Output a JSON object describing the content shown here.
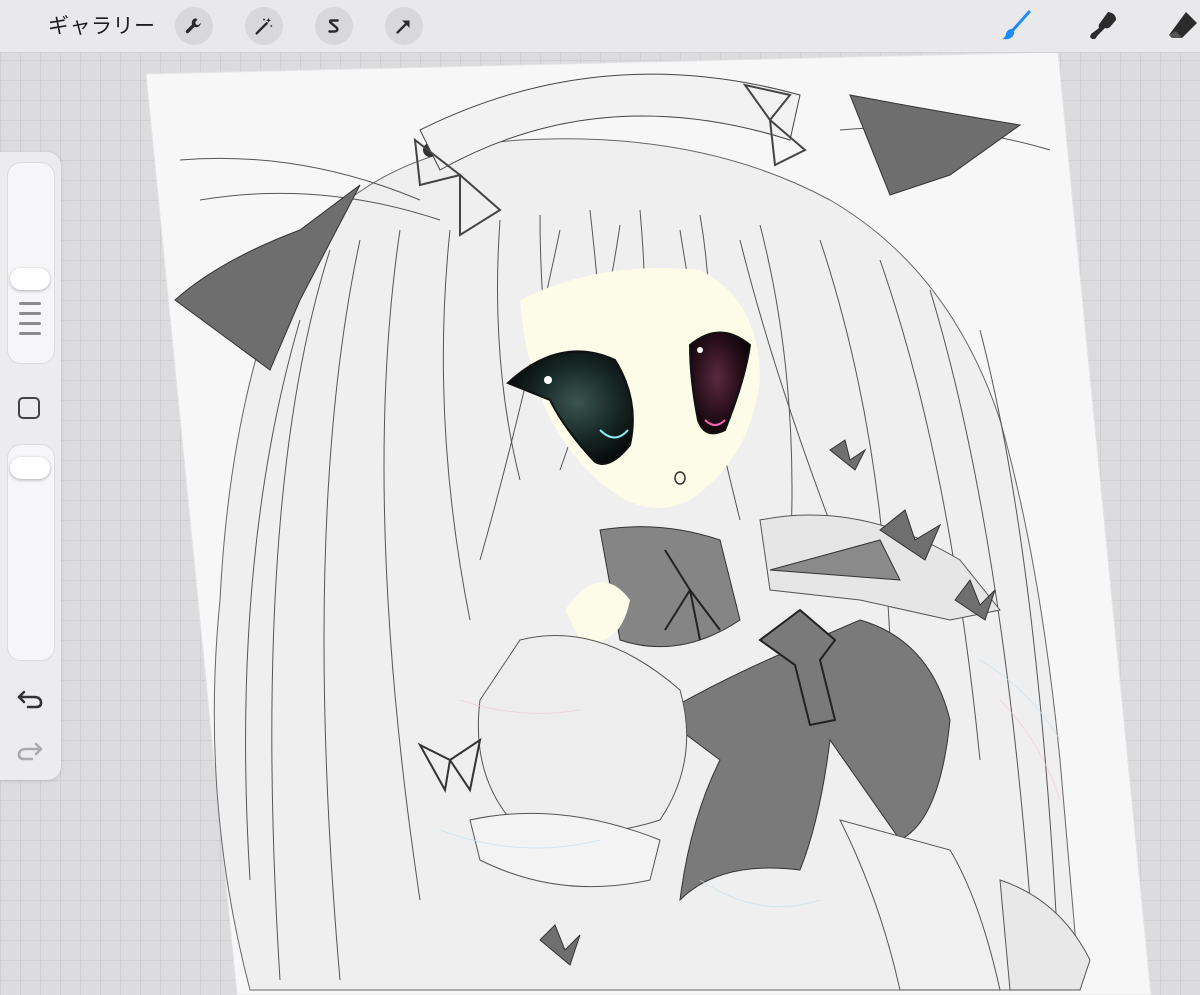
{
  "topbar": {
    "gallery_label": "ギャラリー",
    "left_tools": [
      {
        "icon": "wrench-icon",
        "name": "actions"
      },
      {
        "icon": "magic-wand-icon",
        "name": "adjustments"
      },
      {
        "icon": "selection-s-icon",
        "name": "selection"
      },
      {
        "icon": "arrow-cursor-icon",
        "name": "transform"
      }
    ],
    "right_tools": [
      {
        "icon": "brush-icon",
        "name": "paint",
        "active": true,
        "color": "#1a8cff"
      },
      {
        "icon": "smudge-icon",
        "name": "smudge",
        "active": false,
        "color": "#2b2b2b"
      },
      {
        "icon": "eraser-icon",
        "name": "erase",
        "active": false,
        "color": "#2b2b2b"
      }
    ]
  },
  "sidebar": {
    "brush_size_level": 0.2,
    "opacity_level": 0.07,
    "icons": [
      "undo-arrow-icon",
      "redo-arrow-icon"
    ]
  },
  "colors": {
    "ui_background": "#dcdcde",
    "accent": "#1a8cff",
    "artwork_shading": "#808080"
  }
}
